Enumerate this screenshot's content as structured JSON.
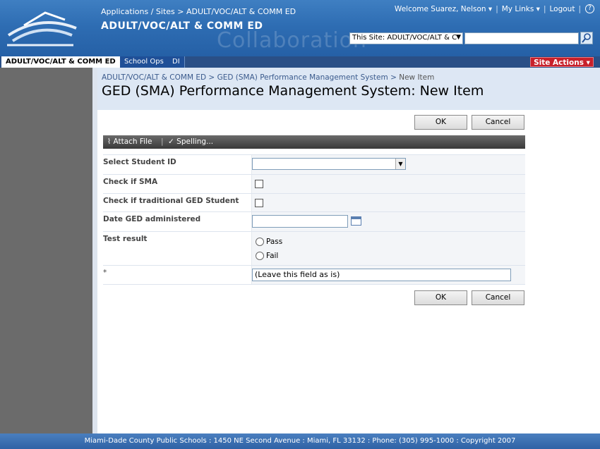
{
  "header": {
    "breadcrumb": [
      "Applications",
      "Sites",
      "ADULT/VOC/ALT & COMM ED"
    ],
    "site_title": "ADULT/VOC/ALT & COMM ED",
    "watermark": "Collaboration",
    "welcome": "Welcome Suarez, Nelson",
    "my_links": "My Links",
    "logout": "Logout",
    "help": "?",
    "search_scope": "This Site: ADULT/VOC/ALT & C",
    "search_value": ""
  },
  "tabs": [
    {
      "label": "ADULT/VOC/ALT & COMM ED",
      "active": true
    },
    {
      "label": "School Ops",
      "active": false
    },
    {
      "label": "DI",
      "active": false
    }
  ],
  "site_actions": "Site Actions",
  "title_area": {
    "breadcrumb": [
      "ADULT/VOC/ALT & COMM ED",
      "GED (SMA) Performance Management System",
      "New Item"
    ],
    "page_title": "GED (SMA) Performance Management System: New Item"
  },
  "buttons": {
    "ok": "OK",
    "cancel": "Cancel"
  },
  "toolbar": {
    "attach": "Attach File",
    "spelling": "Spelling..."
  },
  "form": {
    "student_id_label": "Select Student ID",
    "student_id_value": "",
    "sma_label": "Check if SMA",
    "traditional_label": "Check if traditional GED Student",
    "date_label": "Date GED administered",
    "date_value": "",
    "result_label": "Test result",
    "result_options": [
      "Pass",
      "Fail"
    ],
    "extra_label": "*",
    "extra_value": "(Leave this field as is)"
  },
  "footer": "Miami-Dade County Public Schools : 1450 NE Second Avenue : Miami, FL 33132 : Phone: (305) 995-1000 : Copyright 2007",
  "colors": {
    "header": "#2e6db3",
    "site_actions": "#c8202a",
    "leftnav": "#6b6b6b"
  }
}
